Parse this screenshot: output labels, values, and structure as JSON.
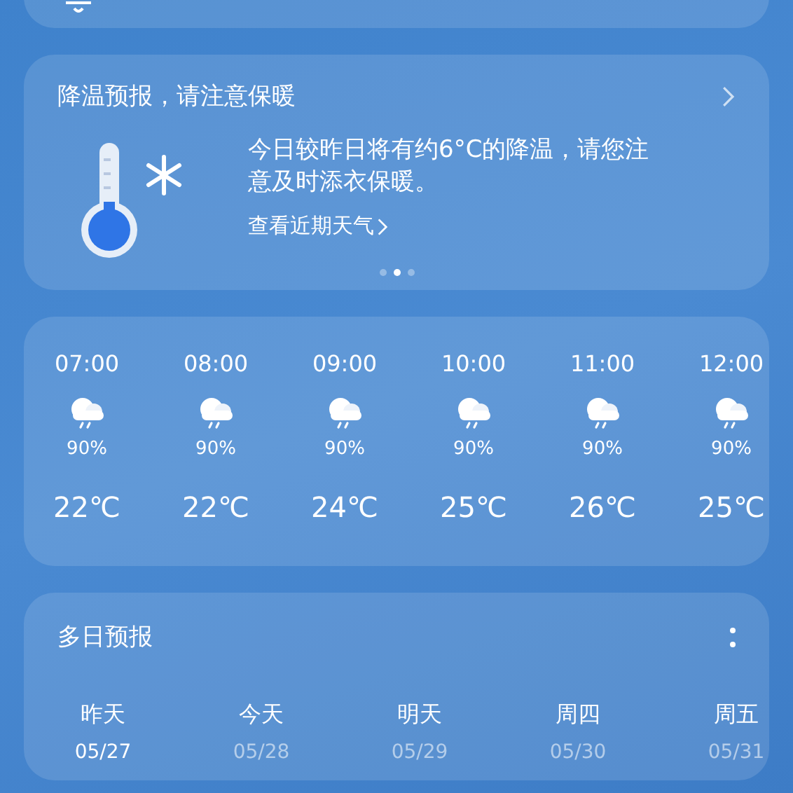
{
  "alert": {
    "title": "降温预报，请注意保暖",
    "message": "今日较昨日将有约6°C的降温，请您注意及时添衣保暖。",
    "link": "查看近期天气",
    "pages": [
      {
        "selected": false
      },
      {
        "selected": true
      },
      {
        "selected": false
      }
    ]
  },
  "hourly": [
    {
      "time": "07:00",
      "chance": "90%",
      "temp": "22℃"
    },
    {
      "time": "08:00",
      "chance": "90%",
      "temp": "22℃"
    },
    {
      "time": "09:00",
      "chance": "90%",
      "temp": "24℃"
    },
    {
      "time": "10:00",
      "chance": "90%",
      "temp": "25℃"
    },
    {
      "time": "11:00",
      "chance": "90%",
      "temp": "26℃"
    },
    {
      "time": "12:00",
      "chance": "90%",
      "temp": "25℃"
    }
  ],
  "daily": {
    "title": "多日预报",
    "days": [
      {
        "day": "昨天",
        "date": "05/27",
        "selected": true
      },
      {
        "day": "今天",
        "date": "05/28",
        "selected": false
      },
      {
        "day": "明天",
        "date": "05/29",
        "selected": false
      },
      {
        "day": "周四",
        "date": "05/30",
        "selected": false
      },
      {
        "day": "周五",
        "date": "05/31",
        "selected": false
      }
    ]
  }
}
